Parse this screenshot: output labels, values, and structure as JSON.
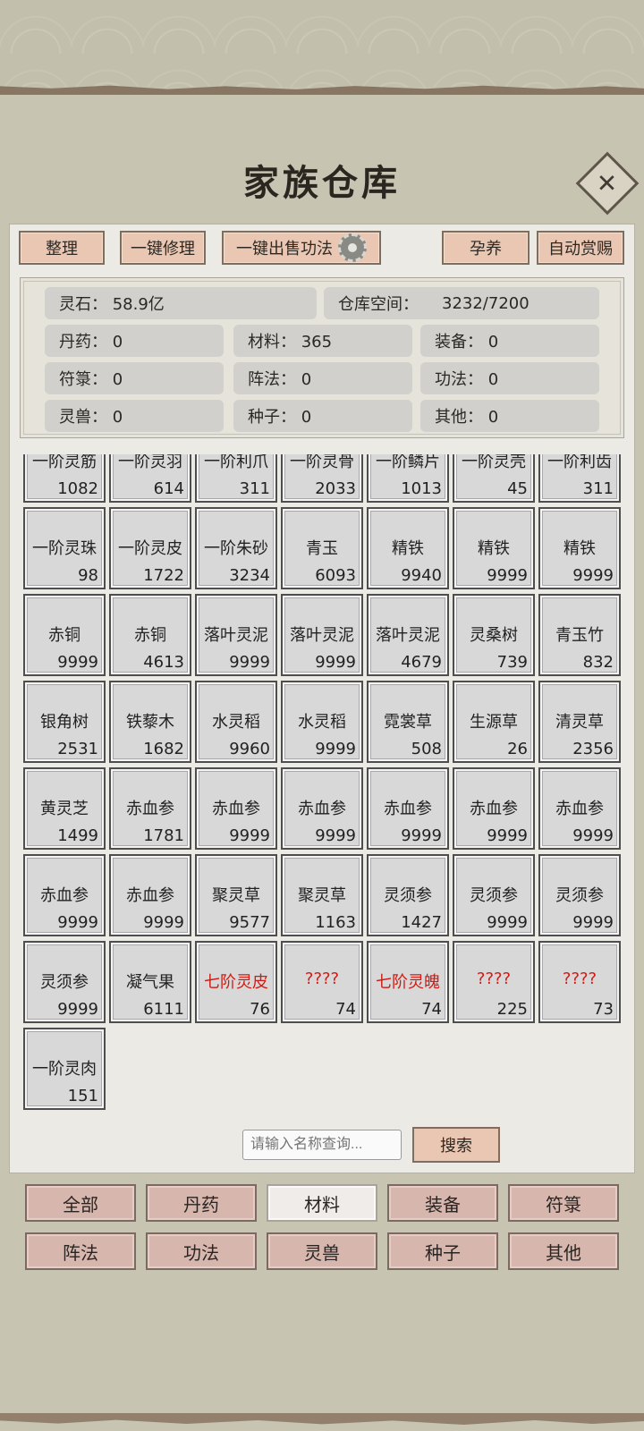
{
  "title": "家族仓库",
  "toolbar": {
    "sort_label": "整理",
    "repair_label": "一键修理",
    "sell_label": "一键出售功法",
    "breed_label": "孕养",
    "reward_label": "自动赏赐"
  },
  "stats": {
    "spirit_stone": "灵石：  58.9亿",
    "storage_label": "仓库空间：",
    "storage_value": "3232/7200",
    "pills": "丹药：  0",
    "materials": "材料：  365",
    "equipment": "装备：  0",
    "talismans": "符箓：  0",
    "formations": "阵法：  0",
    "techniques": "功法：  0",
    "beasts": "灵兽：  0",
    "seeds": "种子：  0",
    "others": "其他：  0"
  },
  "items": [
    {
      "name": "一阶灵筋",
      "count": "1082"
    },
    {
      "name": "一阶灵羽",
      "count": "614"
    },
    {
      "name": "一阶利爪",
      "count": "311"
    },
    {
      "name": "一阶灵骨",
      "count": "2033"
    },
    {
      "name": "一阶鳞片",
      "count": "1013"
    },
    {
      "name": "一阶灵壳",
      "count": "45"
    },
    {
      "name": "一阶利齿",
      "count": "311"
    },
    {
      "name": "一阶灵珠",
      "count": "98"
    },
    {
      "name": "一阶灵皮",
      "count": "1722"
    },
    {
      "name": "一阶朱砂",
      "count": "3234"
    },
    {
      "name": "青玉",
      "count": "6093"
    },
    {
      "name": "精铁",
      "count": "9940"
    },
    {
      "name": "精铁",
      "count": "9999"
    },
    {
      "name": "精铁",
      "count": "9999"
    },
    {
      "name": "赤铜",
      "count": "9999"
    },
    {
      "name": "赤铜",
      "count": "4613"
    },
    {
      "name": "落叶灵泥",
      "count": "9999"
    },
    {
      "name": "落叶灵泥",
      "count": "9999"
    },
    {
      "name": "落叶灵泥",
      "count": "4679"
    },
    {
      "name": "灵桑树",
      "count": "739"
    },
    {
      "name": "青玉竹",
      "count": "832"
    },
    {
      "name": "银角树",
      "count": "2531"
    },
    {
      "name": "铁藜木",
      "count": "1682"
    },
    {
      "name": "水灵稻",
      "count": "9960"
    },
    {
      "name": "水灵稻",
      "count": "9999"
    },
    {
      "name": "霓裳草",
      "count": "508"
    },
    {
      "name": "生源草",
      "count": "26"
    },
    {
      "name": "清灵草",
      "count": "2356"
    },
    {
      "name": "黄灵芝",
      "count": "1499"
    },
    {
      "name": "赤血参",
      "count": "1781"
    },
    {
      "name": "赤血参",
      "count": "9999"
    },
    {
      "name": "赤血参",
      "count": "9999"
    },
    {
      "name": "赤血参",
      "count": "9999"
    },
    {
      "name": "赤血参",
      "count": "9999"
    },
    {
      "name": "赤血参",
      "count": "9999"
    },
    {
      "name": "赤血参",
      "count": "9999"
    },
    {
      "name": "赤血参",
      "count": "9999"
    },
    {
      "name": "聚灵草",
      "count": "9577"
    },
    {
      "name": "聚灵草",
      "count": "1163"
    },
    {
      "name": "灵须参",
      "count": "1427"
    },
    {
      "name": "灵须参",
      "count": "9999"
    },
    {
      "name": "灵须参",
      "count": "9999"
    },
    {
      "name": "灵须参",
      "count": "9999"
    },
    {
      "name": "凝气果",
      "count": "6111"
    },
    {
      "name": "七阶灵皮",
      "count": "76",
      "rare": true
    },
    {
      "name": "????",
      "count": "74",
      "rare": true
    },
    {
      "name": "七阶灵魄",
      "count": "74",
      "rare": true
    },
    {
      "name": "????",
      "count": "225",
      "rare": true
    },
    {
      "name": "????",
      "count": "73",
      "rare": true
    },
    {
      "name": "一阶灵肉",
      "count": "151"
    }
  ],
  "search": {
    "placeholder": "请输入名称查询...",
    "button_label": "搜索"
  },
  "categories": [
    "全部",
    "丹药",
    "材料",
    "装备",
    "符箓",
    "阵法",
    "功法",
    "灵兽",
    "种子",
    "其他"
  ],
  "selected_category": "材料",
  "colors": {
    "rare_item_text": "#d11a14",
    "button_fill": "#e9c7b2",
    "category_fill": "#d7b6ae"
  }
}
